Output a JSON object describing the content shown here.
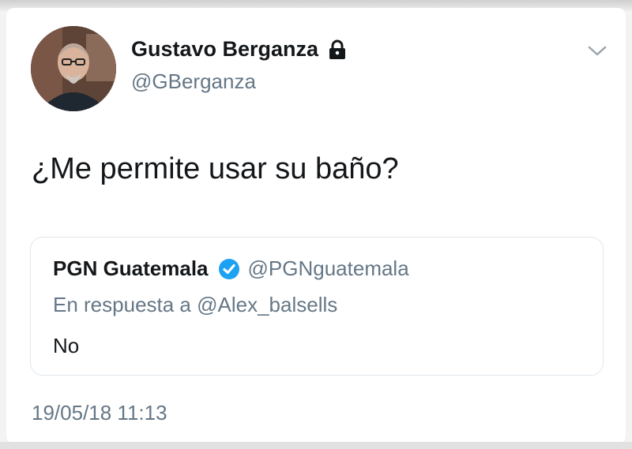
{
  "tweet": {
    "author": {
      "name": "Gustavo Berganza",
      "handle": "@GBerganza",
      "protected": true
    },
    "text": "¿Me permite usar su baño?",
    "quoted_tweet": {
      "name": "PGN Guatemala",
      "verified": true,
      "handle": "@PGNguatemala",
      "reply_context": "En respuesta a @Alex_balsells",
      "text": "No"
    },
    "timestamp": "19/05/18 11:13"
  },
  "icons": {
    "lock": "lock-icon",
    "verified": "verified-badge-icon",
    "menu": "chevron-down-icon"
  },
  "colors": {
    "text": "#14171a",
    "secondary": "#657786",
    "verified_blue": "#1da1f2",
    "border": "#e1e8ed"
  }
}
